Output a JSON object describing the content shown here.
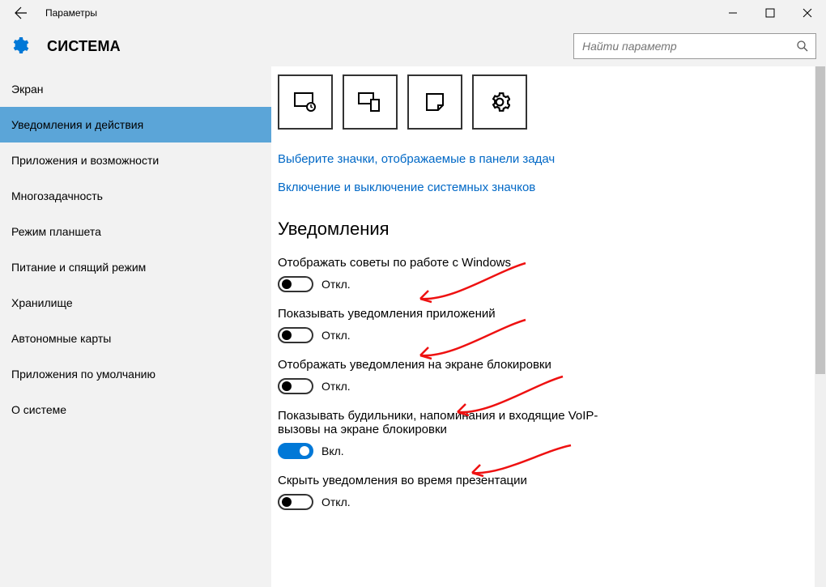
{
  "window": {
    "title": "Параметры"
  },
  "header": {
    "title": "СИСТЕМА",
    "search_placeholder": "Найти параметр"
  },
  "sidebar": {
    "items": [
      {
        "label": "Экран",
        "active": false
      },
      {
        "label": "Уведомления и действия",
        "active": true
      },
      {
        "label": "Приложения и возможности",
        "active": false
      },
      {
        "label": "Многозадачность",
        "active": false
      },
      {
        "label": "Режим планшета",
        "active": false
      },
      {
        "label": "Питание и спящий режим",
        "active": false
      },
      {
        "label": "Хранилище",
        "active": false
      },
      {
        "label": "Автономные карты",
        "active": false
      },
      {
        "label": "Приложения по умолчанию",
        "active": false
      },
      {
        "label": "О системе",
        "active": false
      }
    ]
  },
  "content": {
    "links": [
      "Выберите значки, отображаемые в панели задач",
      "Включение и выключение системных значков"
    ],
    "section_title": "Уведомления",
    "settings": [
      {
        "label": "Отображать советы по работе с Windows",
        "on": false,
        "state": "Откл."
      },
      {
        "label": "Показывать уведомления приложений",
        "on": false,
        "state": "Откл."
      },
      {
        "label": "Отображать уведомления на экране блокировки",
        "on": false,
        "state": "Откл."
      },
      {
        "label": "Показывать будильники, напоминания и входящие VoIP-вызовы на экране блокировки",
        "on": true,
        "state": "Вкл."
      },
      {
        "label": "Скрыть уведомления во время презентации",
        "on": false,
        "state": "Откл."
      }
    ]
  }
}
